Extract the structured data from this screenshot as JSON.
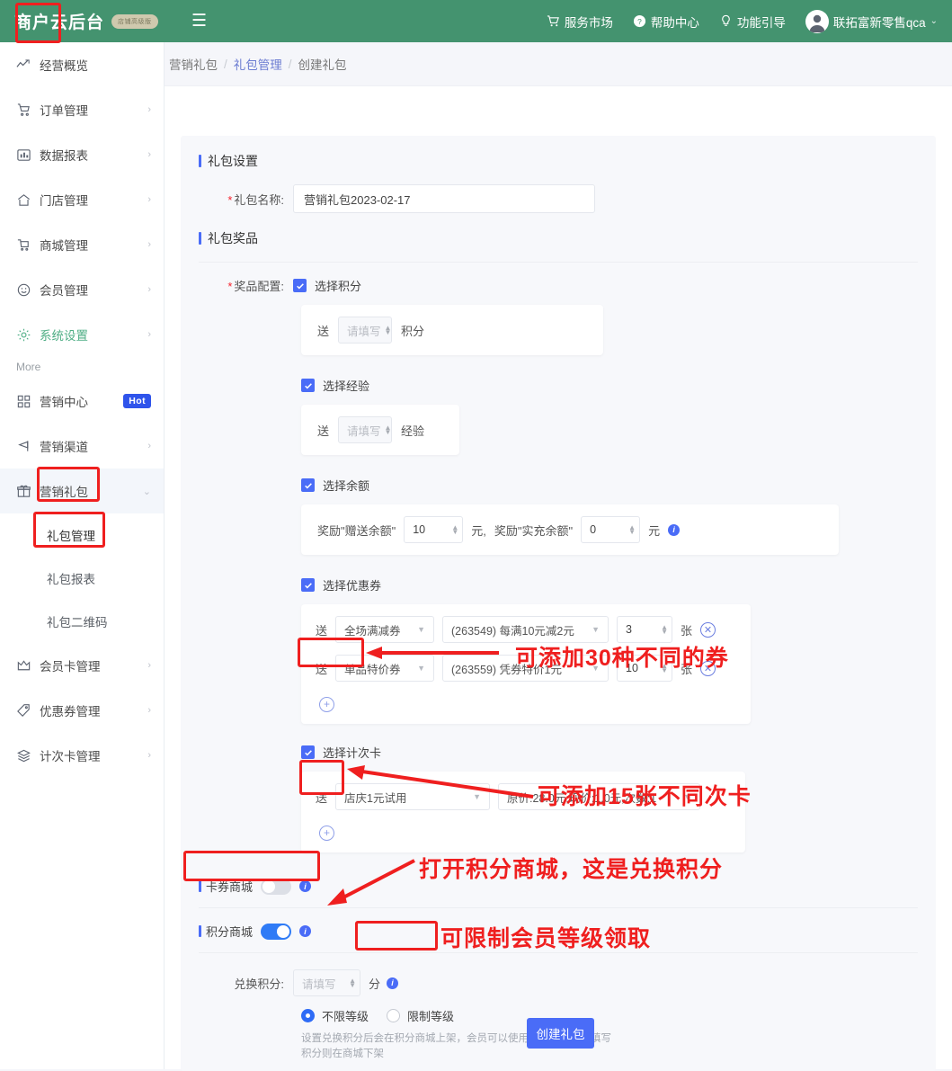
{
  "topbar": {
    "brand_title": "商户云后台",
    "brand_badge": "店铺高级版",
    "menu_icon": "hamburger-icon",
    "links": [
      {
        "label": "服务市场",
        "icon": "cart-icon"
      },
      {
        "label": "帮助中心",
        "icon": "question-circle-icon"
      },
      {
        "label": "功能引导",
        "icon": "bulb-icon"
      }
    ],
    "user_name": "联拓富新零售qca",
    "user_caret": "⌄"
  },
  "sidebar": {
    "items": [
      {
        "label": "经营概览",
        "icon": "trend-line-icon",
        "arrow": "",
        "active": false
      },
      {
        "label": "订单管理",
        "icon": "cart-icon",
        "arrow": "›",
        "active": false
      },
      {
        "label": "数据报表",
        "icon": "bar-chart-icon",
        "arrow": "›",
        "active": false
      },
      {
        "label": "门店管理",
        "icon": "home-icon",
        "arrow": "›",
        "active": false
      },
      {
        "label": "商城管理",
        "icon": "shop-cart-icon",
        "arrow": "›",
        "active": false
      },
      {
        "label": "会员管理",
        "icon": "smiley-icon",
        "arrow": "›",
        "active": false
      },
      {
        "label": "系统设置",
        "icon": "gear-icon",
        "arrow": "›",
        "active": true
      }
    ],
    "more_label": "More",
    "items2": [
      {
        "label": "营销中心",
        "icon": "grid-icon",
        "badge": "Hot"
      },
      {
        "label": "营销渠道",
        "icon": "flag-icon",
        "arrow": "›"
      },
      {
        "label": "营销礼包",
        "icon": "gift-icon",
        "arrow": "⌄"
      }
    ],
    "sub_items": [
      {
        "label": "礼包管理",
        "selected": true
      },
      {
        "label": "礼包报表",
        "selected": false
      },
      {
        "label": "礼包二维码",
        "selected": false
      }
    ],
    "items3": [
      {
        "label": "会员卡管理",
        "icon": "crown-icon",
        "arrow": "›"
      },
      {
        "label": "优惠券管理",
        "icon": "tag-icon",
        "arrow": "›"
      },
      {
        "label": "计次卡管理",
        "icon": "layers-icon",
        "arrow": "›"
      }
    ]
  },
  "breadcrumb": {
    "root": "营销礼包",
    "sep": "/",
    "link": "礼包管理",
    "current": "创建礼包"
  },
  "form": {
    "section_setting": "礼包设置",
    "name_label": "礼包名称:",
    "name_value": "营销礼包2023-02-17",
    "section_prize": "礼包奖品",
    "prize_config_label": "奖品配置:",
    "points": {
      "checkbox_label": "选择积分",
      "send": "送",
      "placeholder": "请填写",
      "unit": "积分"
    },
    "exp": {
      "checkbox_label": "选择经验",
      "send": "送",
      "placeholder": "请填写",
      "unit": "经验"
    },
    "balance": {
      "checkbox_label": "选择余额",
      "gift_label": "奖励\"赠送余额\"",
      "gift_value": "10",
      "gift_unit": "元,",
      "real_label": "奖励\"实充余额\"",
      "real_value": "0",
      "real_unit": "元",
      "info_icon": "info-icon"
    },
    "coupon": {
      "checkbox_label": "选择优惠券",
      "rows": [
        {
          "send": "送",
          "type": "全场满减券",
          "detail": "(263549) 每满10元减2元",
          "qty": "3",
          "qty_unit": "张"
        },
        {
          "send": "送",
          "type": "单品特价券",
          "detail": "(263559) 凭券特价1元",
          "qty": "10",
          "qty_unit": "张"
        }
      ],
      "add_icon": "plus-circle-icon"
    },
    "times_card": {
      "checkbox_label": "选择计次卡",
      "send": "送",
      "name": "店庆1元试用",
      "detail": "原价:28.0元,现价:1.0元,次数:1",
      "add_icon": "plus-circle-icon"
    },
    "card_mall": {
      "label": "卡券商城",
      "on": false,
      "info_icon": "info-icon"
    },
    "points_mall": {
      "label": "积分商城",
      "on": true,
      "info_icon": "info-icon"
    },
    "exchange": {
      "label": "兑换积分:",
      "placeholder": "请填写",
      "unit": "分",
      "info_icon": "info-icon",
      "radio_unlimited": "不限等级",
      "radio_limited": "限制等级",
      "help_line1": "设置兑换积分后会在积分商城上架，会员可以使用积分兑换，不填写",
      "help_line2": "积分则在商城下架"
    },
    "submit_label": "创建礼包"
  },
  "annotations": [
    {
      "text": "可添加30种不同的券"
    },
    {
      "text": "可添加15张不同次卡"
    },
    {
      "text": "打开积分商城，这是兑换积分"
    },
    {
      "text": "可限制会员等级领取"
    }
  ],
  "colors": {
    "header_green": "#44936f",
    "primary_blue": "#4a6cf7",
    "annotation_red": "#ef1f1f",
    "hot_badge": "#2f54eb"
  }
}
